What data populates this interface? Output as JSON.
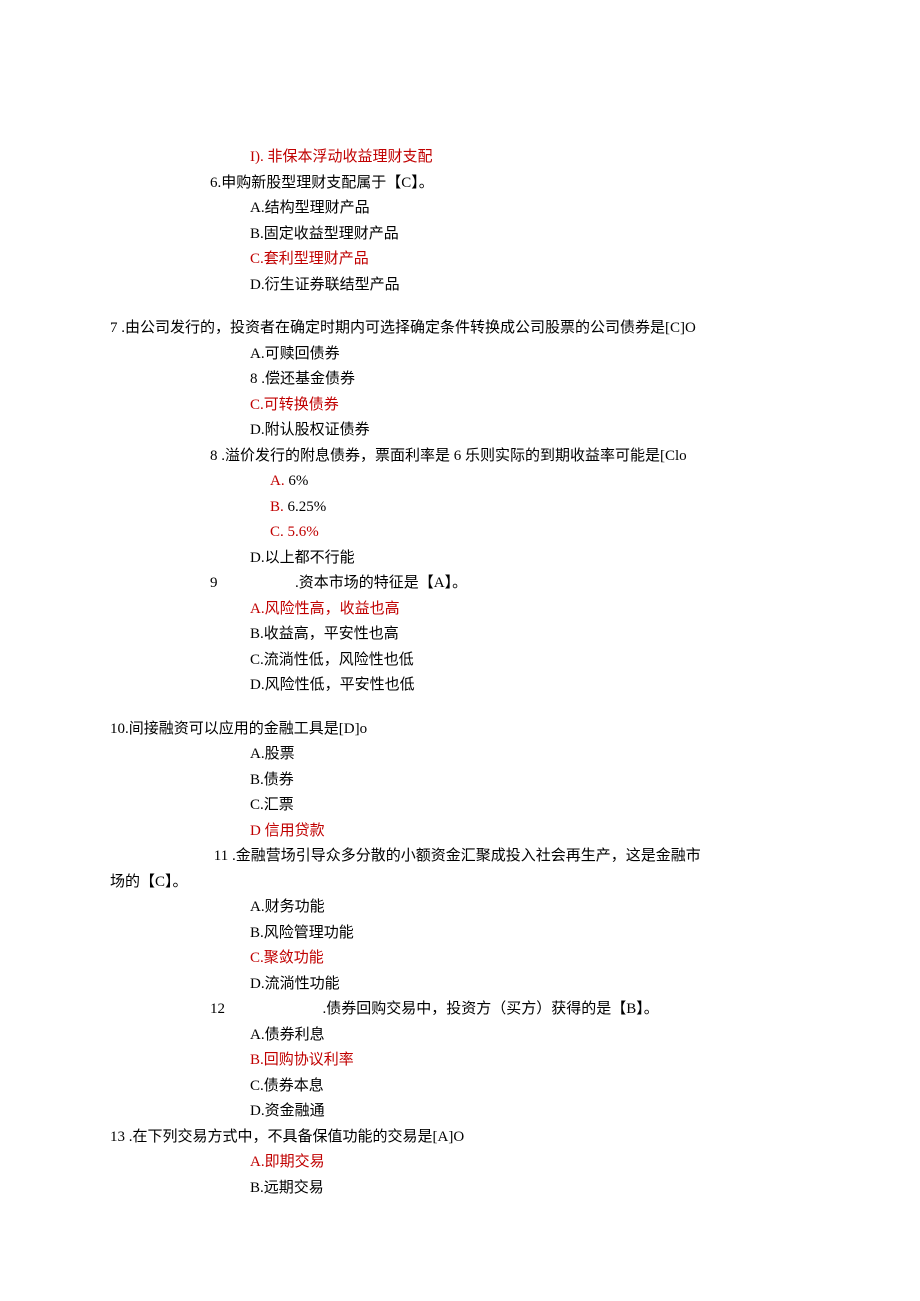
{
  "q5": {
    "optD_label": "I).",
    "optD": "非保本浮动收益理财支配"
  },
  "q6": {
    "text": "6.申购新股型理财支配属于【C】。",
    "optA": "A.结构型理财产品",
    "optB": "B.固定收益型理财产品",
    "optC": "C.套利型理财产品",
    "optD": "D.衍生证券联结型产品"
  },
  "q7": {
    "text": "7 .由公司发行的，投资者在确定时期内可选择确定条件转换成公司股票的公司债券是[C]O",
    "optA": "A.可赎回债券",
    "optB": "8 .偿还基金债券",
    "optC": "C.可转换债券",
    "optD": "D.附认股权证债券"
  },
  "q8": {
    "text": "8 .溢价发行的附息债券，票面利率是 6 乐则实际的到期收益率可能是[Clo",
    "optA_label": "A.",
    "optA": "6%",
    "optB_label": "B.",
    "optB": "6.25%",
    "optC_label": "C.",
    "optC": "5.6%",
    "optD": "D.以上都不行能"
  },
  "q9": {
    "num": "9",
    "text": ".资本市场的特征是【A】。",
    "optA": "A.风险性高，收益也高",
    "optB": "B.收益高，平安性也高",
    "optC": "C.流淌性低，风险性也低",
    "optD": "D.风险性低，平安性也低"
  },
  "q10": {
    "text": "10.间接融资可以应用的金融工具是[D]o",
    "optA": "A.股票",
    "optB": "B.债券",
    "optC": "C.汇票",
    "optD": "D 信用贷款"
  },
  "q11": {
    "num": "11",
    "text_part1": ".金融营场引导众多分散的小额资金汇聚成投入社会再生产，这是金融市",
    "text_part2": "场的【C】。",
    "optA": "A.财务功能",
    "optB": "B.风险管理功能",
    "optC": "C.聚敛功能",
    "optD": "D.流淌性功能"
  },
  "q12": {
    "num": "12",
    "text": ".债券回购交易中，投资方（买方）获得的是【B】。",
    "optA": "A.债券利息",
    "optB": "B.回购协议利率",
    "optC": "C.债券本息",
    "optD": "D.资金融通"
  },
  "q13": {
    "text": "13 .在下列交易方式中，不具备保值功能的交易是[A]O",
    "optA": "A.即期交易",
    "optB": "B.远期交易"
  }
}
